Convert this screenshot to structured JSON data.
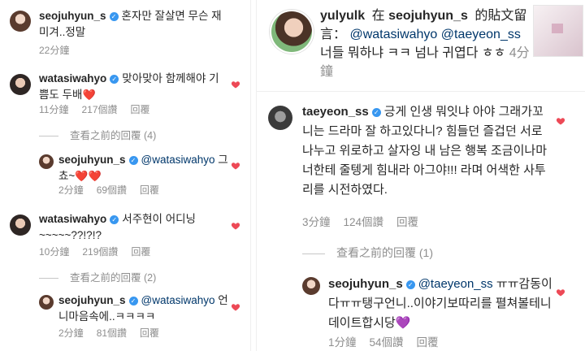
{
  "colors": {
    "heart": "#ed4956",
    "verified": "#3897f0",
    "muted": "#8e8e8e",
    "mention": "#00376b"
  },
  "left": {
    "comment1": {
      "username": "seojuhyun_s",
      "text": "혼자만 잘살면 무슨 재미겨..정말",
      "time": "22分鐘"
    },
    "comment2": {
      "username": "watasiwahyo",
      "text": "맞아맞아 함께해야 기쁨도 두배",
      "emoji": "❤️",
      "time": "11分鐘",
      "likes": "217個讚",
      "reply": "回覆",
      "view_previous": "查看之前的回覆 (4)"
    },
    "reply2": {
      "username": "seojuhyun_s",
      "mention": "@watasiwahyo",
      "text": "그쵸~",
      "emoji": "❤️❤️",
      "time": "2分鐘",
      "likes": "69個讚",
      "reply": "回覆"
    },
    "comment3": {
      "username": "watasiwahyo",
      "text": "서주현이 어디닝~~~~~??!?!?",
      "time": "10分鐘",
      "likes": "219個讚",
      "reply": "回覆",
      "view_previous": "查看之前的回覆 (2)"
    },
    "reply3": {
      "username": "seojuhyun_s",
      "mention": "@watasiwahyo",
      "text": "언니마음속에..ㅋㅋㅋㅋ",
      "time": "2分鐘",
      "likes": "81個讚",
      "reply": "回覆"
    }
  },
  "right": {
    "notification": {
      "username": "yulyulk",
      "text_in": "在",
      "target": "seojuhyun_s",
      "text_post": "的貼文留言：",
      "mention1": "@watasiwahyo",
      "mention2": "@taeyeon_ss",
      "text": "너들 뭐하냐 ㅋㅋ 넘나 귀엽다 ㅎㅎ",
      "time": "4分鐘"
    },
    "comment": {
      "username": "taeyeon_ss",
      "text": "긍게 인생 뭐잇냐 아야 그래가꼬니는 드라마 잘 하고있다니? 힘들던 즐겁던 서로 나누고 위로하고 살자잉 내 남은 행복 조금이나마 너한테 줄텡게 힘내라 아그야!!! 라며 어색한 사투리를 시전하였다.",
      "time": "3分鐘",
      "likes": "124個讚",
      "reply": "回覆",
      "view_previous": "查看之前的回覆 (1)"
    },
    "reply": {
      "username": "seojuhyun_s",
      "mention": "@taeyeon_ss",
      "text": "ㅠㅠ감동이다ㅠㅠ탱구언니..이야기보따리를 펼쳐볼테니 데이트합시당",
      "emoji": "💜",
      "time": "1分鐘",
      "likes": "54個讚",
      "reply": "回覆"
    }
  }
}
